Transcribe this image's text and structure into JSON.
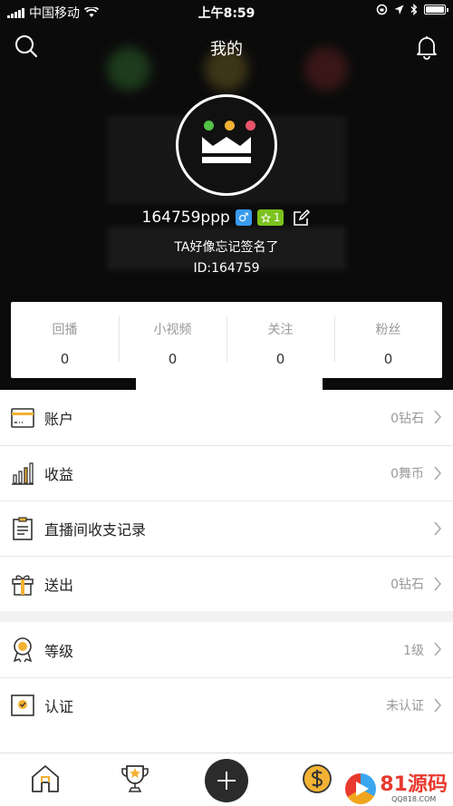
{
  "status_bar": {
    "carrier": "中国移动",
    "time": "上午8:59"
  },
  "nav": {
    "title": "我的"
  },
  "profile": {
    "username": "164759ppp",
    "gender_symbol": "♂",
    "level_badge": "1",
    "signature": "TA好像忘记签名了",
    "id_text": "ID:164759"
  },
  "stats": [
    {
      "label": "回播",
      "value": "0"
    },
    {
      "label": "小视频",
      "value": "0"
    },
    {
      "label": "关注",
      "value": "0"
    },
    {
      "label": "粉丝",
      "value": "0"
    }
  ],
  "menu_group_1": [
    {
      "label": "账户",
      "value": "0钻石",
      "icon": "card-icon"
    },
    {
      "label": "收益",
      "value": "0舞币",
      "icon": "bar-chart-icon"
    },
    {
      "label": "直播间收支记录",
      "value": "",
      "icon": "clipboard-icon"
    },
    {
      "label": "送出",
      "value": "0钻石",
      "icon": "gift-icon"
    }
  ],
  "menu_group_2": [
    {
      "label": "等级",
      "value": "1级",
      "icon": "medal-icon"
    },
    {
      "label": "认证",
      "value": "未认证",
      "icon": "certificate-icon"
    }
  ],
  "watermark": {
    "text": "81源码",
    "sub": "QQ818.COM"
  }
}
